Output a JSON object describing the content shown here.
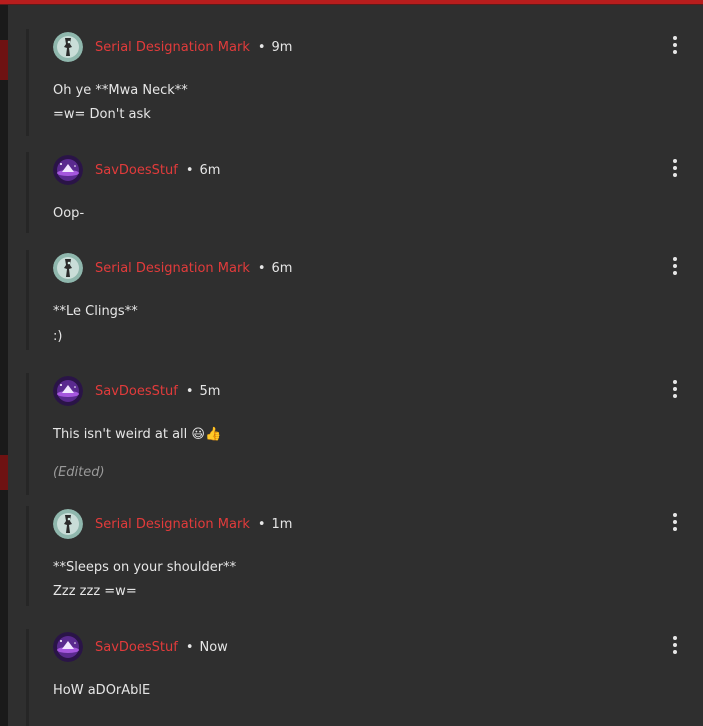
{
  "comments": [
    {
      "author": "Serial Designation Mark",
      "time": "9m",
      "avatar": "robot-avatar",
      "lines": [
        "Oh ye **Mwa Neck**",
        "=w= Don't ask"
      ],
      "edited": ""
    },
    {
      "author": "SavDoesStuf",
      "time": "6m",
      "avatar": "galaxy-avatar",
      "lines": [
        "Oop-"
      ],
      "edited": ""
    },
    {
      "author": "Serial Designation Mark",
      "time": "6m",
      "avatar": "robot-avatar",
      "lines": [
        "**Le Clings**",
        ":)"
      ],
      "edited": ""
    },
    {
      "author": "SavDoesStuf",
      "time": "5m",
      "avatar": "galaxy-avatar",
      "lines": [
        "This isn't weird at all 😃👍"
      ],
      "edited": "(Edited)"
    },
    {
      "author": "Serial Designation Mark",
      "time": "1m",
      "avatar": "robot-avatar",
      "lines": [
        "**Sleeps on your shoulder**",
        "Zzz zzz =w="
      ],
      "edited": ""
    },
    {
      "author": "SavDoesStuf",
      "time": "Now",
      "avatar": "galaxy-avatar",
      "lines": [
        "HoW aDOrAblE"
      ],
      "edited": ""
    }
  ],
  "separator": "•",
  "colors": {
    "author": "#e23b3b",
    "accent": "#b81d1d",
    "background": "#2f2f2f"
  }
}
